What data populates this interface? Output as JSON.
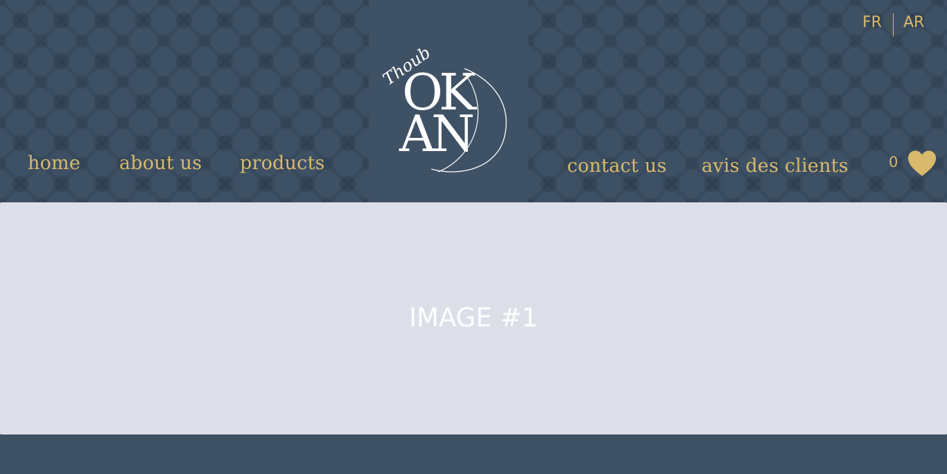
{
  "header": {
    "nav_left": [
      {
        "label": "home"
      },
      {
        "label": "about us"
      },
      {
        "label": "products"
      }
    ],
    "nav_right": [
      {
        "label": "contact us"
      },
      {
        "label": "avis des clients"
      }
    ],
    "languages": [
      "FR",
      "AR"
    ],
    "cart_count": "0",
    "logo": {
      "script_text": "Thoub",
      "line1": "OK",
      "line2": "AN"
    }
  },
  "hero": {
    "label": "IMAGE #1"
  },
  "colors": {
    "background": "#3f5164",
    "accent_gold": "#d9b96c",
    "hero_placeholder": "#dcdfe8",
    "logo_white": "#ffffff"
  },
  "icons": {
    "wishlist": "heart-icon"
  }
}
